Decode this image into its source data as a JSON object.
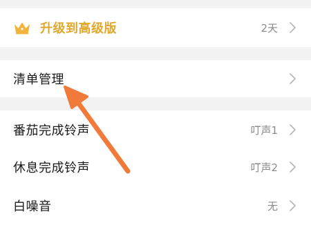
{
  "upgrade": {
    "label": "升级到高级版",
    "value": "2天",
    "icon": "crown-icon",
    "accent_color": "#e0a82e"
  },
  "list_management": {
    "label": "清单管理"
  },
  "settings": [
    {
      "label": "番茄完成铃声",
      "value": "叮声1"
    },
    {
      "label": "休息完成铃声",
      "value": "叮声2"
    },
    {
      "label": "白噪音",
      "value": "无"
    }
  ],
  "annotation": {
    "icon": "pointer-arrow-icon",
    "color": "#f07a3a"
  }
}
